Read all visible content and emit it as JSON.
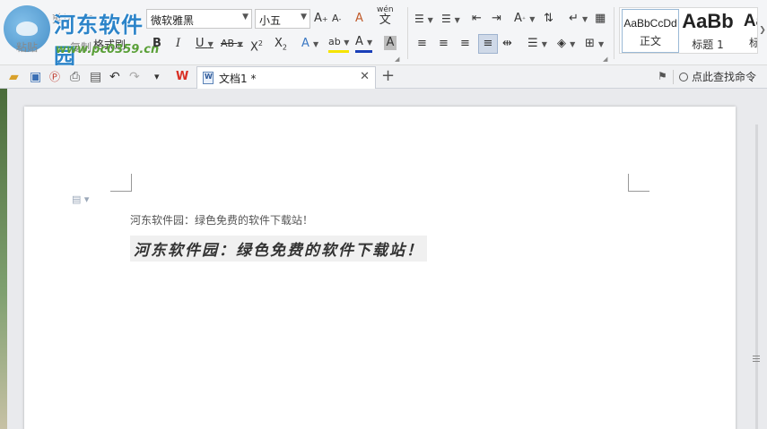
{
  "clipboard": {
    "paste_label": "粘贴",
    "cut_label": "剪切",
    "copy_label": "复制",
    "format_painter_label": "格式刷"
  },
  "watermark": {
    "site_name": "河东软件园",
    "url": "www.pc0359.cn"
  },
  "font": {
    "name": "微软雅黑",
    "size": "小五"
  },
  "font_tools": {
    "grow": "A",
    "shrink": "A",
    "clear": "A",
    "pinyin": "wén",
    "pinyin_char": "文",
    "bold": "B",
    "italic": "I",
    "underline": "U",
    "strike": "AB",
    "superscript": "X",
    "subscript": "X",
    "text_effect": "A",
    "highlight": "ab",
    "font_color": "A",
    "char_shading": "A"
  },
  "styles": {
    "normal_sample": "AaBbCcDd",
    "normal_label": "正文",
    "heading1_sample": "AaBb",
    "heading1_label": "标题 1",
    "heading2_sample": "Aa",
    "heading2_label": "标"
  },
  "tabs": [
    {
      "title": "文档1 *"
    }
  ],
  "find_command": "点此查找命令",
  "document": {
    "line1": "河东软件园：绿色免费的软件下载站！",
    "line2": "河东软件园：绿色免费的软件下载站！"
  },
  "colors": {
    "highlight": "#f5e400",
    "font_color": "#1a3fb8",
    "watermark": "#2c84c9",
    "watermark_url": "#5aa038"
  }
}
